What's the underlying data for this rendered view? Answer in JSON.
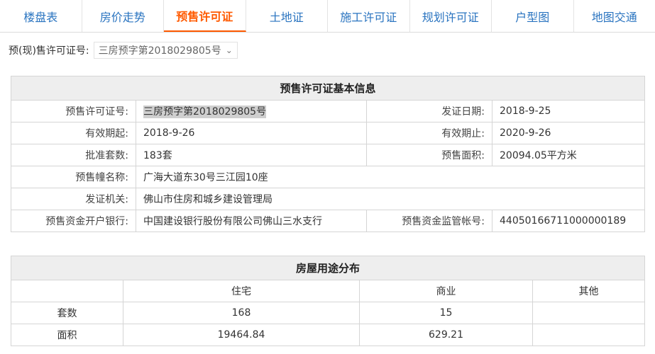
{
  "tabs": [
    {
      "label": "楼盘表",
      "active": false
    },
    {
      "label": "房价走势",
      "active": false
    },
    {
      "label": "预售许可证",
      "active": true
    },
    {
      "label": "土地证",
      "active": false
    },
    {
      "label": "施工许可证",
      "active": false
    },
    {
      "label": "规划许可证",
      "active": false
    },
    {
      "label": "户型图",
      "active": false
    },
    {
      "label": "地图交通",
      "active": false
    }
  ],
  "permit_select": {
    "label": "预(现)售许可证号:",
    "value": "三房预字第2018029805号"
  },
  "basic_info": {
    "title": "预售许可证基本信息",
    "permit_no_label": "预售许可证号:",
    "permit_no": "三房预字第2018029805号",
    "issue_date_label": "发证日期:",
    "issue_date": "2018-9-25",
    "valid_from_label": "有效期起:",
    "valid_from": "2018-9-26",
    "valid_to_label": "有效期止:",
    "valid_to": "2020-9-26",
    "units_label": "批准套数:",
    "units": "183套",
    "area_label": "预售面积:",
    "area": "20094.05平方米",
    "building_label": "预售幢名称:",
    "building": "广海大道东30号三江园10座",
    "authority_label": "发证机关:",
    "authority": "佛山市住房和城乡建设管理局",
    "bank_label": "预售资金开户银行:",
    "bank": "中国建设银行股份有限公司佛山三水支行",
    "account_label": "预售资金监管帐号:",
    "account": "44050166711000000189"
  },
  "usage": {
    "title": "房屋用途分布",
    "columns": [
      "",
      "住宅",
      "商业",
      "其他"
    ],
    "rows": [
      {
        "label": "套数",
        "residential": "168",
        "commercial": "15",
        "other": ""
      },
      {
        "label": "面积",
        "residential": "19464.84",
        "commercial": "629.21",
        "other": ""
      }
    ]
  }
}
